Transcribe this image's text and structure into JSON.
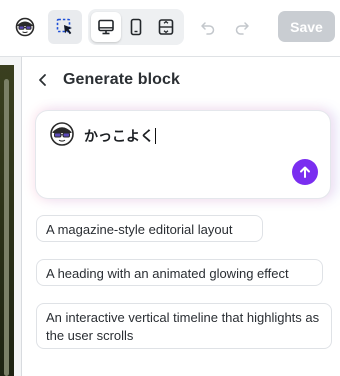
{
  "toolbar": {
    "icons": [
      "user-avatar-icon",
      "select-pointer-icon",
      "desktop-icon",
      "mobile-icon",
      "responsive-icon",
      "undo-icon",
      "redo-icon"
    ],
    "save_label": "Save",
    "active_device": "desktop"
  },
  "panel": {
    "title": "Generate block",
    "prompt": {
      "value": "かっこよく",
      "send_icon": "arrow-up-icon"
    },
    "suggestions": [
      {
        "label": "A magazine-style editorial layout"
      },
      {
        "label": "A heading with an animated glowing effect"
      },
      {
        "label": "An interactive vertical timeline that highlights as the user scrolls"
      }
    ]
  },
  "colors": {
    "accent": "#7a2ef0",
    "save_disabled": "#c9cdd2",
    "selected_tool_bg": "#e9ebee"
  }
}
